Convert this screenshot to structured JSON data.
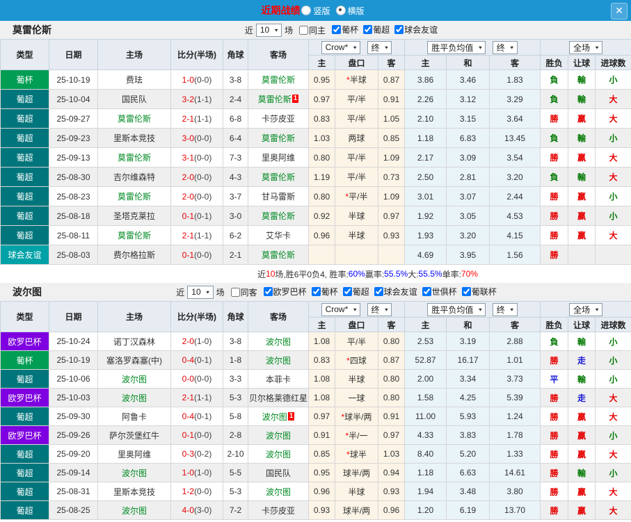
{
  "titlebar": {
    "title": "近期战绩",
    "layout_options": [
      {
        "label": "竖版",
        "selected": false
      },
      {
        "label": "横版",
        "selected": true
      }
    ],
    "close_icon": "✕"
  },
  "filter_labels": {
    "near": "近",
    "count": "10",
    "matches": "场"
  },
  "table": {
    "columns": {
      "type": "类型",
      "date": "日期",
      "home": "主场",
      "score": "比分(半场)",
      "corner": "角球",
      "away": "客场",
      "odds_home": "主",
      "odds_pan": "盘口",
      "odds_away": "客",
      "avg_home": "主",
      "avg_draw": "和",
      "avg_away": "客",
      "wl": "胜负",
      "handicap": "让球",
      "goals": "进球数"
    },
    "dropdowns": {
      "crow": "Crow*",
      "final1": "终",
      "avg": "胜平负均值",
      "final2": "终",
      "scope": "全场"
    }
  },
  "type_colors": {
    "葡杯": "#009e54",
    "葡超": "#00767c",
    "球会友谊": "#00a2a8",
    "欧罗巴杯": "#7e00e0"
  },
  "accent_colors": {
    "topbar": "#1d95d3",
    "win": "#e60000",
    "loss": "#007800",
    "draw": "#1616d6",
    "team_green": "#008a22"
  },
  "sections": [
    {
      "team": "莫雷伦斯",
      "same_label": "同主",
      "same_checked": false,
      "leagues": [
        {
          "label": "葡杯",
          "checked": true
        },
        {
          "label": "葡超",
          "checked": true
        },
        {
          "label": "球会友谊",
          "checked": true
        }
      ],
      "rows": [
        {
          "lg": "葡杯",
          "date": "25-10-19",
          "home": "费珐",
          "hg": false,
          "ft": "1-0",
          "ht": "(0-0)",
          "cn": "3-8",
          "away": "莫雷伦斯",
          "ag": true,
          "bd": "",
          "oh": "0.95",
          "st": "*",
          "pk": "半球",
          "oa": "0.87",
          "ah": "3.86",
          "ad": "3.46",
          "aa": "1.83",
          "wl": "負",
          "wc": "g",
          "hc": "輸",
          "hcc": "g",
          "gl": "小",
          "gc": "g"
        },
        {
          "lg": "葡超",
          "date": "25-10-04",
          "home": "国民队",
          "hg": false,
          "ft": "3-2",
          "ht": "(1-1)",
          "cn": "2-4",
          "away": "莫雷伦斯",
          "ag": true,
          "bd": "1",
          "oh": "0.97",
          "st": "",
          "pk": "平/半",
          "oa": "0.91",
          "ah": "2.26",
          "ad": "3.12",
          "aa": "3.29",
          "wl": "負",
          "wc": "g",
          "hc": "輸",
          "hcc": "g",
          "gl": "大",
          "gc": "r"
        },
        {
          "lg": "葡超",
          "date": "25-09-27",
          "home": "莫雷伦斯",
          "hg": true,
          "ft": "2-1",
          "ht": "(1-1)",
          "cn": "6-8",
          "away": "卡莎皮亚",
          "ag": false,
          "bd": "",
          "oh": "0.83",
          "st": "",
          "pk": "平/半",
          "oa": "1.05",
          "ah": "2.10",
          "ad": "3.15",
          "aa": "3.64",
          "wl": "勝",
          "wc": "r",
          "hc": "贏",
          "hcc": "r",
          "gl": "大",
          "gc": "r"
        },
        {
          "lg": "葡超",
          "date": "25-09-23",
          "home": "里斯本竞技",
          "hg": false,
          "ft": "3-0",
          "ht": "(0-0)",
          "cn": "6-4",
          "away": "莫雷伦斯",
          "ag": true,
          "bd": "",
          "oh": "1.03",
          "st": "",
          "pk": "两球",
          "oa": "0.85",
          "ah": "1.18",
          "ad": "6.83",
          "aa": "13.45",
          "wl": "負",
          "wc": "g",
          "hc": "輸",
          "hcc": "g",
          "gl": "小",
          "gc": "g"
        },
        {
          "lg": "葡超",
          "date": "25-09-13",
          "home": "莫雷伦斯",
          "hg": true,
          "ft": "3-1",
          "ht": "(0-0)",
          "cn": "7-3",
          "away": "里奥阿维",
          "ag": false,
          "bd": "",
          "oh": "0.80",
          "st": "",
          "pk": "平/半",
          "oa": "1.09",
          "ah": "2.17",
          "ad": "3.09",
          "aa": "3.54",
          "wl": "勝",
          "wc": "r",
          "hc": "贏",
          "hcc": "r",
          "gl": "大",
          "gc": "r"
        },
        {
          "lg": "葡超",
          "date": "25-08-30",
          "home": "吉尔维森特",
          "hg": false,
          "ft": "2-0",
          "ht": "(0-0)",
          "cn": "4-3",
          "away": "莫雷伦斯",
          "ag": true,
          "bd": "",
          "oh": "1.19",
          "st": "",
          "pk": "平/半",
          "oa": "0.73",
          "ah": "2.50",
          "ad": "2.81",
          "aa": "3.20",
          "wl": "負",
          "wc": "g",
          "hc": "輸",
          "hcc": "g",
          "gl": "大",
          "gc": "r"
        },
        {
          "lg": "葡超",
          "date": "25-08-23",
          "home": "莫雷伦斯",
          "hg": true,
          "ft": "2-0",
          "ht": "(0-0)",
          "cn": "3-7",
          "away": "甘马雷斯",
          "ag": false,
          "bd": "",
          "oh": "0.80",
          "st": "*",
          "pk": "平/半",
          "oa": "1.09",
          "ah": "3.01",
          "ad": "3.07",
          "aa": "2.44",
          "wl": "勝",
          "wc": "r",
          "hc": "贏",
          "hcc": "r",
          "gl": "小",
          "gc": "g"
        },
        {
          "lg": "葡超",
          "date": "25-08-18",
          "home": "圣塔克莱拉",
          "hg": false,
          "ft": "0-1",
          "ht": "(0-1)",
          "cn": "3-0",
          "away": "莫雷伦斯",
          "ag": true,
          "bd": "",
          "oh": "0.92",
          "st": "",
          "pk": "半球",
          "oa": "0.97",
          "ah": "1.92",
          "ad": "3.05",
          "aa": "4.53",
          "wl": "勝",
          "wc": "r",
          "hc": "贏",
          "hcc": "r",
          "gl": "小",
          "gc": "g"
        },
        {
          "lg": "葡超",
          "date": "25-08-11",
          "home": "莫雷伦斯",
          "hg": true,
          "ft": "2-1",
          "ht": "(1-1)",
          "cn": "6-2",
          "away": "艾华卡",
          "ag": false,
          "bd": "",
          "oh": "0.96",
          "st": "",
          "pk": "半球",
          "oa": "0.93",
          "ah": "1.93",
          "ad": "3.20",
          "aa": "4.15",
          "wl": "勝",
          "wc": "r",
          "hc": "贏",
          "hcc": "r",
          "gl": "大",
          "gc": "r"
        },
        {
          "lg": "球会友谊",
          "date": "25-08-03",
          "home": "费尔格拉斯",
          "hg": false,
          "ft": "0-1",
          "ht": "(0-0)",
          "cn": "2-1",
          "away": "莫雷伦斯",
          "ag": true,
          "bd": "",
          "oh": "",
          "st": "",
          "pk": "",
          "oa": "",
          "ah": "4.69",
          "ad": "3.95",
          "aa": "1.56",
          "wl": "勝",
          "wc": "r",
          "hc": "",
          "hcc": "g",
          "gl": "",
          "gc": "g"
        }
      ],
      "summary_text": [
        {
          "t": "近",
          "c": "k"
        },
        {
          "t": "10",
          "c": "r"
        },
        {
          "t": "场,胜6平0负4, 胜率:",
          "c": "k"
        },
        {
          "t": "60%",
          "c": "b"
        },
        {
          "t": " 赢率:",
          "c": "k"
        },
        {
          "t": "55.5%",
          "c": "b"
        },
        {
          "t": " 大:",
          "c": "k"
        },
        {
          "t": "55.5%",
          "c": "b"
        },
        {
          "t": " 单率:",
          "c": "k"
        },
        {
          "t": "70%",
          "c": "r"
        }
      ]
    },
    {
      "team": "波尔图",
      "same_label": "同客",
      "same_checked": false,
      "leagues": [
        {
          "label": "欧罗巴杯",
          "checked": true
        },
        {
          "label": "葡杯",
          "checked": true
        },
        {
          "label": "葡超",
          "checked": true
        },
        {
          "label": "球会友谊",
          "checked": true
        },
        {
          "label": "世俱杯",
          "checked": true
        },
        {
          "label": "葡联杯",
          "checked": true
        }
      ],
      "rows": [
        {
          "lg": "欧罗巴杯",
          "date": "25-10-24",
          "home": "诺丁汉森林",
          "hg": false,
          "ft": "2-0",
          "ht": "(1-0)",
          "cn": "3-8",
          "away": "波尔图",
          "ag": true,
          "bd": "",
          "oh": "1.08",
          "st": "",
          "pk": "平/半",
          "oa": "0.80",
          "ah": "2.53",
          "ad": "3.19",
          "aa": "2.88",
          "wl": "負",
          "wc": "g",
          "hc": "輸",
          "hcc": "g",
          "gl": "小",
          "gc": "g"
        },
        {
          "lg": "葡杯",
          "date": "25-10-19",
          "home": "塞洛罗森塞(中)",
          "hg": false,
          "ft": "0-4",
          "ht": "(0-1)",
          "cn": "1-8",
          "away": "波尔图",
          "ag": true,
          "bd": "",
          "oh": "0.83",
          "st": "*",
          "pk": "四球",
          "oa": "0.87",
          "ah": "52.87",
          "ad": "16.17",
          "aa": "1.01",
          "wl": "勝",
          "wc": "r",
          "hc": "走",
          "hcc": "b",
          "gl": "小",
          "gc": "g"
        },
        {
          "lg": "葡超",
          "date": "25-10-06",
          "home": "波尔图",
          "hg": true,
          "ft": "0-0",
          "ht": "(0-0)",
          "cn": "3-3",
          "away": "本菲卡",
          "ag": false,
          "bd": "",
          "oh": "1.08",
          "st": "",
          "pk": "半球",
          "oa": "0.80",
          "ah": "2.00",
          "ad": "3.34",
          "aa": "3.73",
          "wl": "平",
          "wc": "b",
          "hc": "輸",
          "hcc": "g",
          "gl": "小",
          "gc": "g"
        },
        {
          "lg": "欧罗巴杯",
          "date": "25-10-03",
          "home": "波尔图",
          "hg": true,
          "ft": "2-1",
          "ht": "(1-1)",
          "cn": "5-3",
          "away": "贝尔格莱德红星",
          "ag": false,
          "bd": "",
          "oh": "1.08",
          "st": "",
          "pk": "一球",
          "oa": "0.80",
          "ah": "1.58",
          "ad": "4.25",
          "aa": "5.39",
          "wl": "勝",
          "wc": "r",
          "hc": "走",
          "hcc": "b",
          "gl": "大",
          "gc": "r"
        },
        {
          "lg": "葡超",
          "date": "25-09-30",
          "home": "阿鲁卡",
          "hg": false,
          "ft": "0-4",
          "ht": "(0-1)",
          "cn": "5-8",
          "away": "波尔图",
          "ag": true,
          "bd": "1",
          "oh": "0.97",
          "st": "*",
          "pk": "球半/两",
          "oa": "0.91",
          "ah": "11.00",
          "ad": "5.93",
          "aa": "1.24",
          "wl": "勝",
          "wc": "r",
          "hc": "贏",
          "hcc": "r",
          "gl": "大",
          "gc": "r"
        },
        {
          "lg": "欧罗巴杯",
          "date": "25-09-26",
          "home": "萨尔茨堡红牛",
          "hg": false,
          "ft": "0-1",
          "ht": "(0-0)",
          "cn": "2-8",
          "away": "波尔图",
          "ag": true,
          "bd": "",
          "oh": "0.91",
          "st": "*",
          "pk": "半/一",
          "oa": "0.97",
          "ah": "4.33",
          "ad": "3.83",
          "aa": "1.78",
          "wl": "勝",
          "wc": "r",
          "hc": "贏",
          "hcc": "r",
          "gl": "小",
          "gc": "g"
        },
        {
          "lg": "葡超",
          "date": "25-09-20",
          "home": "里奥阿维",
          "hg": false,
          "ft": "0-3",
          "ht": "(0-2)",
          "cn": "2-10",
          "away": "波尔图",
          "ag": true,
          "bd": "",
          "oh": "0.85",
          "st": "*",
          "pk": "球半",
          "oa": "1.03",
          "ah": "8.40",
          "ad": "5.20",
          "aa": "1.33",
          "wl": "勝",
          "wc": "r",
          "hc": "贏",
          "hcc": "r",
          "gl": "大",
          "gc": "r"
        },
        {
          "lg": "葡超",
          "date": "25-09-14",
          "home": "波尔图",
          "hg": true,
          "ft": "1-0",
          "ht": "(1-0)",
          "cn": "5-5",
          "away": "国民队",
          "ag": false,
          "bd": "",
          "oh": "0.95",
          "st": "",
          "pk": "球半/两",
          "oa": "0.94",
          "ah": "1.18",
          "ad": "6.63",
          "aa": "14.61",
          "wl": "勝",
          "wc": "r",
          "hc": "輸",
          "hcc": "g",
          "gl": "小",
          "gc": "g"
        },
        {
          "lg": "葡超",
          "date": "25-08-31",
          "home": "里斯本竞技",
          "hg": false,
          "ft": "1-2",
          "ht": "(0-0)",
          "cn": "5-3",
          "away": "波尔图",
          "ag": true,
          "bd": "",
          "oh": "0.96",
          "st": "",
          "pk": "半球",
          "oa": "0.93",
          "ah": "1.94",
          "ad": "3.48",
          "aa": "3.80",
          "wl": "勝",
          "wc": "r",
          "hc": "贏",
          "hcc": "r",
          "gl": "大",
          "gc": "r"
        },
        {
          "lg": "葡超",
          "date": "25-08-25",
          "home": "波尔图",
          "hg": true,
          "ft": "4-0",
          "ht": "(3-0)",
          "cn": "7-2",
          "away": "卡莎皮亚",
          "ag": false,
          "bd": "",
          "oh": "0.93",
          "st": "",
          "pk": "球半/两",
          "oa": "0.96",
          "ah": "1.20",
          "ad": "6.19",
          "aa": "13.70",
          "wl": "勝",
          "wc": "r",
          "hc": "贏",
          "hcc": "r",
          "gl": "大",
          "gc": "r"
        }
      ],
      "summary_text": null
    }
  ]
}
